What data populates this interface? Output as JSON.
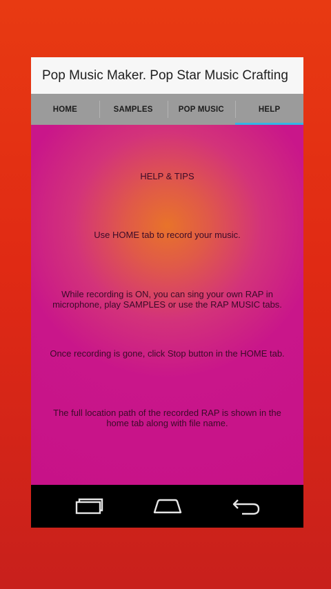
{
  "app": {
    "title": "Pop Music Maker. Pop Star Music Crafting"
  },
  "tabs": [
    {
      "label": "HOME"
    },
    {
      "label": "SAMPLES"
    },
    {
      "label": "POP MUSIC"
    },
    {
      "label": "HELP"
    }
  ],
  "help": {
    "heading": "HELP & TIPS",
    "tip1": "Use HOME tab to record your music.",
    "tip2": "While recording is ON, you can sing your own RAP in microphone, play SAMPLES or use the RAP MUSIC tabs.",
    "tip3": "Once recording is gone, click Stop button in the HOME tab.",
    "tip4": "The full location path of the recorded RAP is shown in the home tab along with file name."
  },
  "navbar": {
    "icons": [
      "recent-apps-icon",
      "home-icon",
      "back-icon"
    ]
  },
  "colors": {
    "accent": "#33b5e5",
    "background": "#e83a12",
    "content": "#c9168a"
  }
}
